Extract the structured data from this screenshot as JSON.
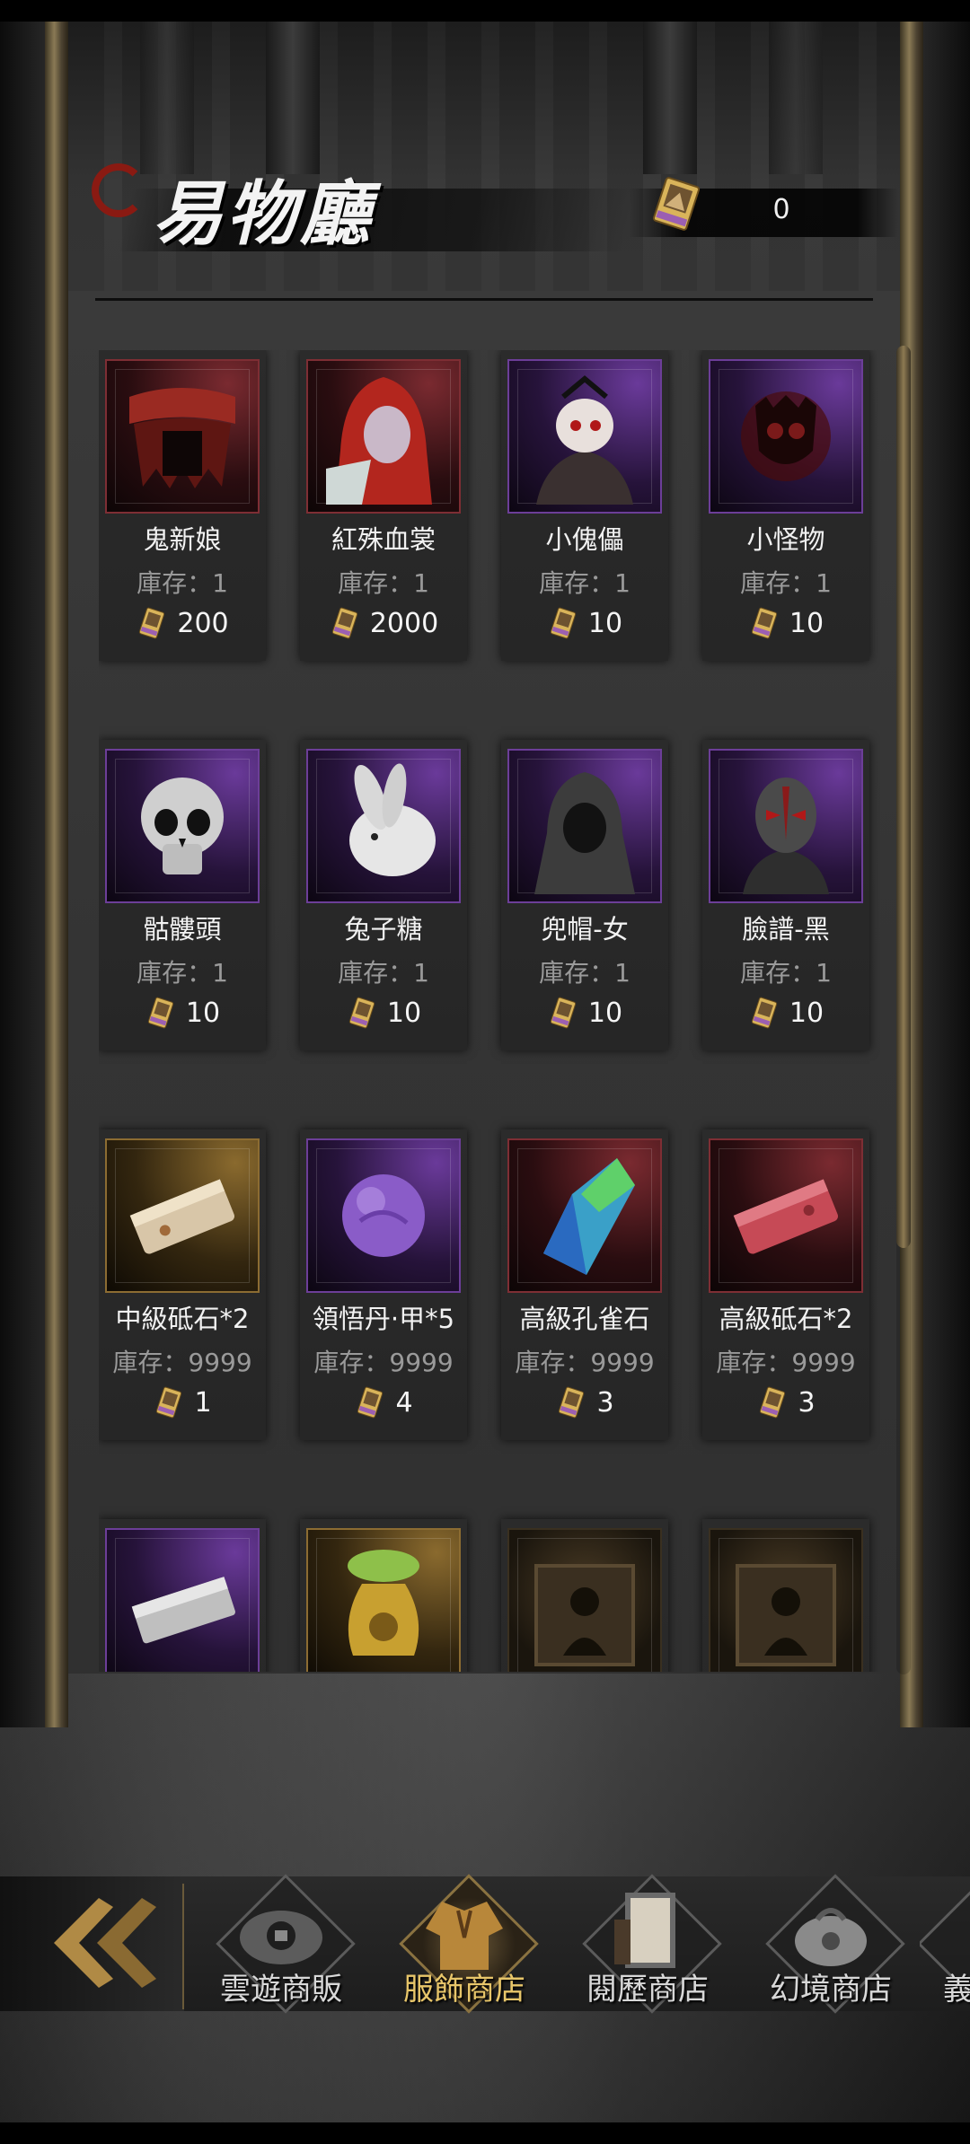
{
  "header": {
    "title": "易物廳",
    "currency_value": "0",
    "currency_icon": "ticket-icon"
  },
  "items": [
    {
      "name": "鬼新娘",
      "stock_label": "庫存：",
      "stock": "1",
      "price": "200",
      "frame": "red",
      "icon": "bridal-veil-icon"
    },
    {
      "name": "紅殊血裳",
      "stock_label": "庫存：",
      "stock": "1",
      "price": "2000",
      "frame": "red",
      "icon": "red-hooded-woman-icon"
    },
    {
      "name": "小傀儡",
      "stock_label": "庫存：",
      "stock": "1",
      "price": "10",
      "frame": "purple",
      "icon": "puppet-icon"
    },
    {
      "name": "小怪物",
      "stock_label": "庫存：",
      "stock": "1",
      "price": "10",
      "frame": "purple",
      "icon": "monster-mask-icon"
    },
    {
      "name": "骷髏頭",
      "stock_label": "庫存：",
      "stock": "1",
      "price": "10",
      "frame": "purple",
      "icon": "skull-icon"
    },
    {
      "name": "兔子糖",
      "stock_label": "庫存：",
      "stock": "1",
      "price": "10",
      "frame": "purple",
      "icon": "rabbit-icon"
    },
    {
      "name": "兜帽-女",
      "stock_label": "庫存：",
      "stock": "1",
      "price": "10",
      "frame": "purple",
      "icon": "hood-icon"
    },
    {
      "name": "臉譜-黑",
      "stock_label": "庫存：",
      "stock": "1",
      "price": "10",
      "frame": "purple",
      "icon": "opera-mask-icon"
    },
    {
      "name": "中級砥石*2",
      "stock_label": "庫存：",
      "stock": "9999",
      "price": "1",
      "frame": "gold",
      "icon": "whetstone-icon"
    },
    {
      "name": "領悟丹·甲*5",
      "stock_label": "庫存：",
      "stock": "9999",
      "price": "4",
      "frame": "purple",
      "icon": "purple-orb-icon"
    },
    {
      "name": "高級孔雀石",
      "stock_label": "庫存：",
      "stock": "9999",
      "price": "3",
      "frame": "red",
      "icon": "malachite-crystal-icon"
    },
    {
      "name": "高級砥石*2",
      "stock_label": "庫存：",
      "stock": "9999",
      "price": "3",
      "frame": "red",
      "icon": "red-whetstone-icon"
    },
    {
      "name": "",
      "stock_label": "",
      "stock": "",
      "price": "",
      "frame": "purple",
      "icon": "silver-ingot-icon"
    },
    {
      "name": "",
      "stock_label": "",
      "stock": "",
      "price": "",
      "frame": "gold",
      "icon": "money-bag-icon"
    },
    {
      "name": "",
      "stock_label": "",
      "stock": "",
      "price": "",
      "frame": "dark",
      "icon": "locked-chest-icon"
    },
    {
      "name": "",
      "stock_label": "",
      "stock": "",
      "price": "",
      "frame": "dark",
      "icon": "locked-chest-icon"
    }
  ],
  "nav": {
    "back_icon": "double-chevron-left-icon",
    "tabs": [
      {
        "label": "雲遊商販",
        "icon": "traveling-merchant-icon",
        "active": false
      },
      {
        "label": "服飾商店",
        "icon": "clothing-icon",
        "active": true
      },
      {
        "label": "閱歷商店",
        "icon": "scroll-book-icon",
        "active": false
      },
      {
        "label": "幻境商店",
        "icon": "treasure-bag-icon",
        "active": false
      },
      {
        "label": "義",
        "icon": "partial-tab-icon",
        "active": false
      }
    ]
  },
  "colors": {
    "active_tab": "#e8c66a",
    "stock_text": "#9a9a9a",
    "frame_red": "#7e2e34",
    "frame_purple": "#6c3e98",
    "frame_gold": "#8c6c32"
  }
}
